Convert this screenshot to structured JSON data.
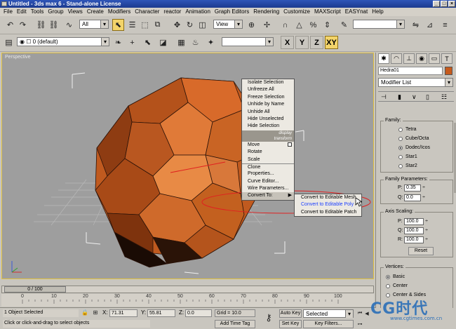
{
  "window": {
    "title": "Untitled - 3ds max 6 - Stand-alone License"
  },
  "menubar": [
    "File",
    "Edit",
    "Tools",
    "Group",
    "Views",
    "Create",
    "Modifiers",
    "Character",
    "reactor",
    "Animation",
    "Graph Editors",
    "Rendering",
    "Customize",
    "MAXScript",
    "EASYnat",
    "Help"
  ],
  "toolbar": {
    "selection_filter": "All",
    "reference_coord": "View",
    "layer": "0 (default)",
    "axis_buttons": [
      "X",
      "Y",
      "Z",
      "XY"
    ]
  },
  "viewport": {
    "label": "Perspective"
  },
  "quad_menu": {
    "display_items": [
      "Isolate Selection",
      "Unfreeze All",
      "Freeze Selection",
      "Unhide by Name",
      "Unhide All",
      "Hide Unselected",
      "Hide Selection"
    ],
    "display_label": "display",
    "transform_label": "transform",
    "transform_items": [
      "Move",
      "Rotate",
      "Scale",
      "Clone",
      "Properties...",
      "Curve Editor...",
      "Wire Parameters...",
      "Convert To:"
    ],
    "convert_submenu": [
      "Convert to Editable Mesh",
      "Convert to Editable Poly",
      "Convert to Editable Patch"
    ]
  },
  "timeline": {
    "slider": "0 / 100",
    "ticks": [
      "0",
      "10",
      "20",
      "30",
      "40",
      "50",
      "60",
      "70",
      "80",
      "90",
      "100"
    ]
  },
  "status": {
    "selection_info": "1 Object Selected",
    "prompt": "Click or click-and-drag to select objects",
    "x_label": "X:",
    "x_value": "71.31",
    "y_label": "Y:",
    "y_value": "55.81",
    "z_label": "Z:",
    "z_value": "0.0",
    "grid": "Grid = 10.0",
    "add_time_tag": "Add Time Tag",
    "auto_key": "Auto Key",
    "set_key": "Set Key",
    "key_mode": "Selected",
    "key_filters": "Key Filters..."
  },
  "panel": {
    "object_name": "Hedra01",
    "object_color": "#c65a1c",
    "modifier_list": "Modifier List",
    "family_title": "Family:",
    "family_options": [
      "Tetra",
      "Cube/Octa",
      "Dodec/Icos",
      "Star1",
      "Star2"
    ],
    "family_selected": "Dodec/Icos",
    "family_params_title": "Family Parameters:",
    "p_label": "P:",
    "p_value": "0.35",
    "q_label": "Q:",
    "q_value": "0.0",
    "axis_scaling_title": "Axis Scaling:",
    "ap_label": "P:",
    "ap_value": "100.0",
    "aq_label": "Q:",
    "aq_value": "100.0",
    "ar_label": "R:",
    "ar_value": "100.0",
    "reset_label": "Reset",
    "vertices_title": "Vertices:",
    "vertex_options": [
      "Basic",
      "Center",
      "Center & Sides"
    ],
    "vertex_selected": "Basic"
  },
  "watermark": {
    "logo": "CG时代",
    "url": "www.cgtimes.com.cn"
  },
  "colors": {
    "title_bar": "#1b3a8f",
    "highlight": "#f3d46a",
    "object": "#c65a1c",
    "viewport_bg": "#9e9e9e"
  }
}
